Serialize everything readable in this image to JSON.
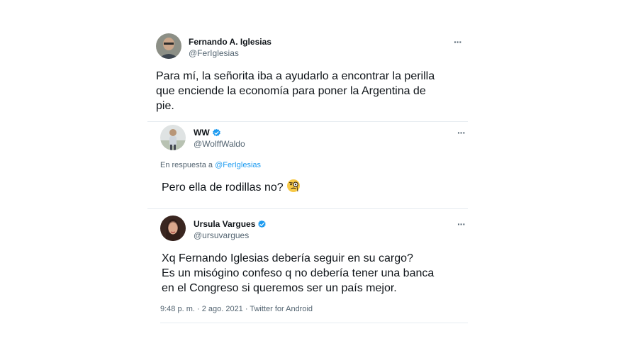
{
  "tweets": [
    {
      "name": "Fernando A. Iglesias",
      "handle": "@FerIglesias",
      "text_lines": [
        "Para mí, la señorita iba a ayudarlo a encontrar la perilla",
        "que enciende la economía para poner la Argentina de",
        "pie."
      ],
      "more_label": "···",
      "verified": false
    },
    {
      "name": "WW",
      "handle": "@WolffWaldo",
      "reply_prefix": "En respuesta a",
      "reply_mention": "@FerIglesias",
      "text": "Pero ella de rodillas no?",
      "emoji_icon": "face-with-monocle-icon",
      "more_label": "···",
      "verified": true
    },
    {
      "name": "Ursula Vargues",
      "handle": "@ursuvargues",
      "text_lines": [
        "Xq Fernando Iglesias debería seguir en su cargo?",
        "Es un misógino confeso q no debería tener una banca",
        "en el Congreso si queremos ser un país mejor."
      ],
      "timestamp": "9:48 p. m. · 2 ago. 2021 · Twitter for Android",
      "more_label": "···",
      "verified": true
    }
  ],
  "colors": {
    "verified_badge": "#1d9bf0",
    "mention": "#1d9bf0",
    "secondary_text": "#536471",
    "divider": "#e6ecf0"
  }
}
